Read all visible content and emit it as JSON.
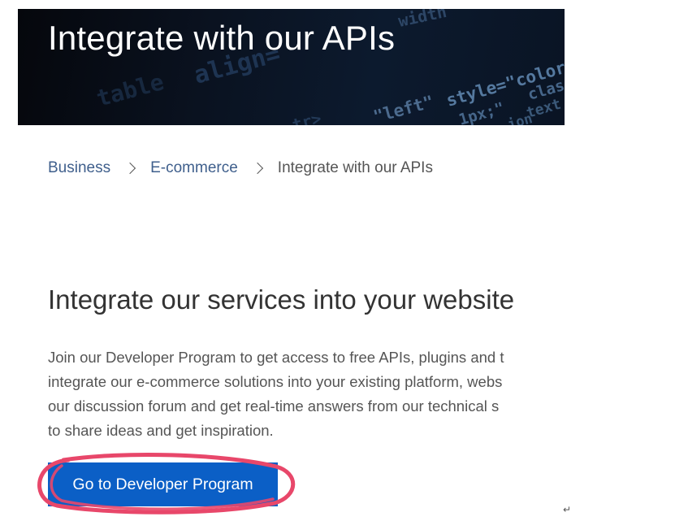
{
  "hero": {
    "title": "Integrate with our APIs",
    "code_fragments": [
      "width",
      "align=",
      "style=\"color",
      "\"left\"",
      "1px;\"",
      "class",
      "text",
      "table",
      "tr>",
      "ion"
    ]
  },
  "breadcrumb": {
    "items": [
      {
        "label": "Business"
      },
      {
        "label": "E-commerce"
      }
    ],
    "current": "Integrate with our APIs",
    "separator_icon": "chevron-right-icon"
  },
  "section": {
    "heading": "Integrate our services into your website",
    "paragraph_lines": [
      "Join our Developer Program to get access to free APIs, plugins and t",
      "integrate our e-commerce solutions into your existing platform, webs",
      "our discussion forum and get real-time answers from our technical s",
      "to share ideas and get inspiration."
    ]
  },
  "cta": {
    "label": "Go to Developer Program"
  },
  "misc": {
    "return_glyph": "↵"
  },
  "colors": {
    "link": "#3f5f8c",
    "button": "#0b5fc6",
    "highlight": "#e8476a",
    "text": "#555555",
    "heading": "#333333"
  }
}
